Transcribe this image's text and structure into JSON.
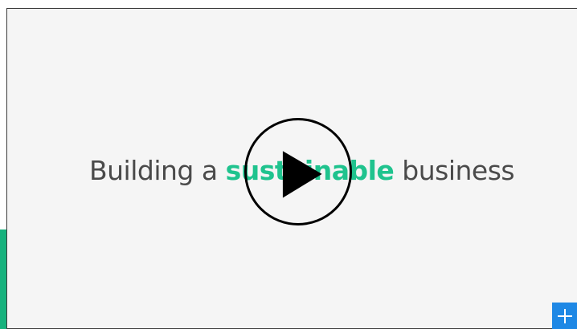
{
  "video": {
    "headline_before": "Building a ",
    "headline_accent": "sustainable",
    "headline_after": " business",
    "accent_color": "#1fc38e",
    "play_icon": "play-icon"
  },
  "side_accent": {
    "color": "#16b27d"
  },
  "expand_button": {
    "icon": "plus-icon",
    "color": "#1e88e5"
  }
}
